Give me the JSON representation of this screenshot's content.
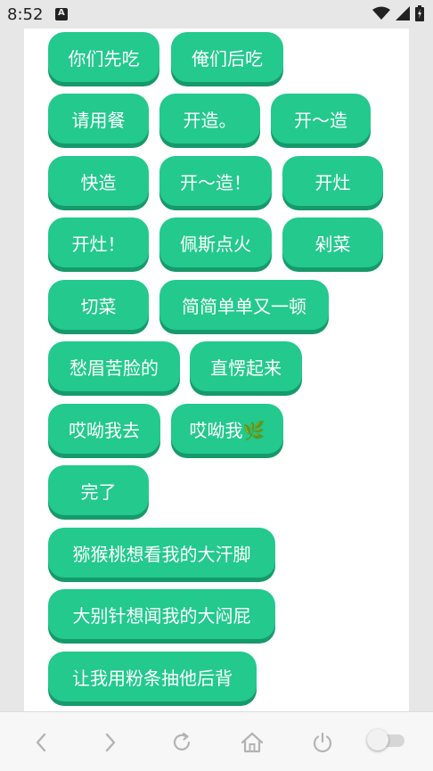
{
  "status_bar": {
    "time": "8:52"
  },
  "buttons": [
    "你们先吃",
    "俺们后吃",
    "请用餐",
    "开造。",
    "开～造",
    "快造",
    "开～造！",
    "开灶",
    "开灶！",
    "佩斯点火",
    "剁菜",
    "切菜",
    "简简单单又一顿",
    "愁眉苦脸的",
    "直愣起来",
    "哎呦我去",
    "哎呦我🌿",
    "完了",
    "猕猴桃想看我的大汗脚",
    "大别针想闻我的大闷屁",
    "让我用粉条抽他后背"
  ],
  "colors": {
    "button_bg": "#23c98d",
    "button_shadow": "#169a6b"
  },
  "icons": [
    "back-arrow-icon",
    "forward-arrow-icon",
    "refresh-icon",
    "home-icon",
    "power-icon",
    "toggle-switch"
  ]
}
